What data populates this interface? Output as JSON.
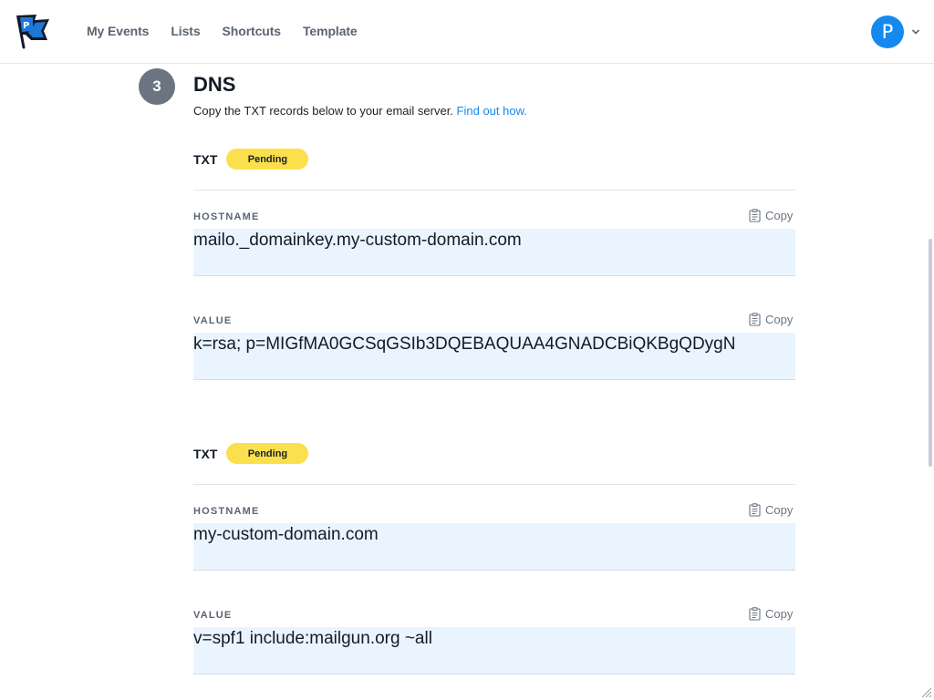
{
  "nav": {
    "items": [
      "My Events",
      "Lists",
      "Shortcuts",
      "Template"
    ]
  },
  "user": {
    "initial": "P"
  },
  "step": {
    "number": "3",
    "title": "DNS",
    "description": "Copy the TXT records below to your email server.",
    "link": "Find out how."
  },
  "records": [
    {
      "type": "TXT",
      "status": "Pending",
      "hostname_label": "HOSTNAME",
      "hostname": "mailo._domainkey.my-custom-domain.com",
      "value_label": "VALUE",
      "value": "k=rsa; p=MIGfMA0GCSqGSIb3DQEBAQUAA4GNADCBiQKBgQDygN",
      "copy_label": "Copy"
    },
    {
      "type": "TXT",
      "status": "Pending",
      "hostname_label": "HOSTNAME",
      "hostname": "my-custom-domain.com",
      "value_label": "VALUE",
      "value": "v=spf1 include:mailgun.org ~all",
      "copy_label": "Copy"
    }
  ],
  "colors": {
    "accent": "#1589ee",
    "pending": "#fbe04e",
    "field_bg": "#eaf4ff"
  },
  "icons": [
    "logo-flag-icon",
    "chevron-down-icon",
    "clipboard-icon",
    "resize-handle-icon"
  ]
}
